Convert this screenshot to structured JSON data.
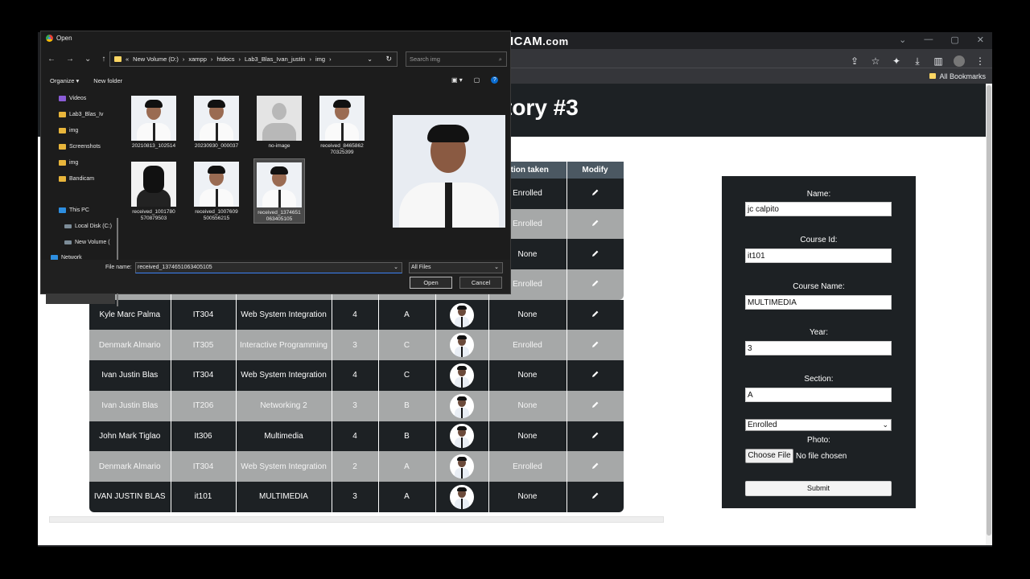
{
  "watermark": {
    "main": "www.BANDICAM",
    "suffix": ".com"
  },
  "browser": {
    "bookmarks_label": "All Bookmarks",
    "page_title_visible": "tory #3"
  },
  "table": {
    "headers": [
      "",
      "",
      "",
      "",
      "",
      "",
      "ction taken",
      "Modify"
    ],
    "partial_rows_action": [
      "Enrolled",
      "Enrolled",
      "None",
      "Enrolled"
    ],
    "rows": [
      {
        "name": "Kyle Marc Palma",
        "course_id": "IT304",
        "course_name": "Web System Integration",
        "year": "4",
        "section": "A",
        "action": "None"
      },
      {
        "name": "Denmark Almario",
        "course_id": "IT305",
        "course_name": "Interactive Programming",
        "year": "3",
        "section": "C",
        "action": "Enrolled"
      },
      {
        "name": "Ivan Justin Blas",
        "course_id": "IT304",
        "course_name": "Web System Integration",
        "year": "4",
        "section": "C",
        "action": "None"
      },
      {
        "name": "Ivan Justin Blas",
        "course_id": "IT206",
        "course_name": "Networking 2",
        "year": "3",
        "section": "B",
        "action": "None"
      },
      {
        "name": "John Mark Tiglao",
        "course_id": "It306",
        "course_name": "Multimedia",
        "year": "4",
        "section": "B",
        "action": "None"
      },
      {
        "name": "Denmark Almario",
        "course_id": "IT304",
        "course_name": "Web System Integration",
        "year": "2",
        "section": "A",
        "action": "Enrolled"
      },
      {
        "name": "IVAN JUSTIN BLAS",
        "course_id": "it101",
        "course_name": "MULTIMEDIA",
        "year": "3",
        "section": "A",
        "action": "None"
      }
    ]
  },
  "form": {
    "name_label": "Name:",
    "name_value": "jc calpito",
    "course_id_label": "Course Id:",
    "course_id_value": "it101",
    "course_name_label": "Course Name:",
    "course_name_value": "MULTIMEDIA",
    "year_label": "Year:",
    "year_value": "3",
    "section_label": "Section:",
    "section_value": "A",
    "status_value": "Enrolled",
    "photo_label": "Photo:",
    "choose_file_label": "Choose File",
    "no_file_text": "No file chosen",
    "submit_label": "Submit"
  },
  "dialog": {
    "title": "Open",
    "address": [
      "New Volume (D:)",
      "xampp",
      "htdocs",
      "Lab3_Blas_Ivan_justin",
      "img"
    ],
    "search_placeholder": "Search img",
    "organize_label": "Organize",
    "new_folder_label": "New folder",
    "nav_items": [
      {
        "label": "Videos",
        "icon": "videos-folder-icon"
      },
      {
        "label": "Lab3_Blas_Iv",
        "icon": "folder-icon"
      },
      {
        "label": "img",
        "icon": "folder-icon"
      },
      {
        "label": "Screenshots",
        "icon": "folder-icon"
      },
      {
        "label": "img",
        "icon": "folder-icon"
      },
      {
        "label": "Bandicam",
        "icon": "folder-icon"
      },
      {
        "label": "This PC",
        "icon": "pc-icon"
      },
      {
        "label": "Local Disk (C:)",
        "icon": "drive-icon"
      },
      {
        "label": "New Volume (",
        "icon": "drive-icon"
      },
      {
        "label": "Network",
        "icon": "network-icon"
      }
    ],
    "files": [
      {
        "line1": "20210813_102514",
        "line2": ""
      },
      {
        "line1": "20230930_000037",
        "line2": ""
      },
      {
        "line1": "no-image",
        "line2": ""
      },
      {
        "line1": "received_8465862",
        "line2": "70325399"
      },
      {
        "line1": "received_1001780",
        "line2": "570879503"
      },
      {
        "line1": "received_1007609",
        "line2": "500556215"
      },
      {
        "line1": "received_1374651",
        "line2": "063405105"
      }
    ],
    "file_name_label": "File name:",
    "file_name_value": "received_1374651063405105",
    "file_type_value": "All Files",
    "open_label": "Open",
    "cancel_label": "Cancel"
  }
}
